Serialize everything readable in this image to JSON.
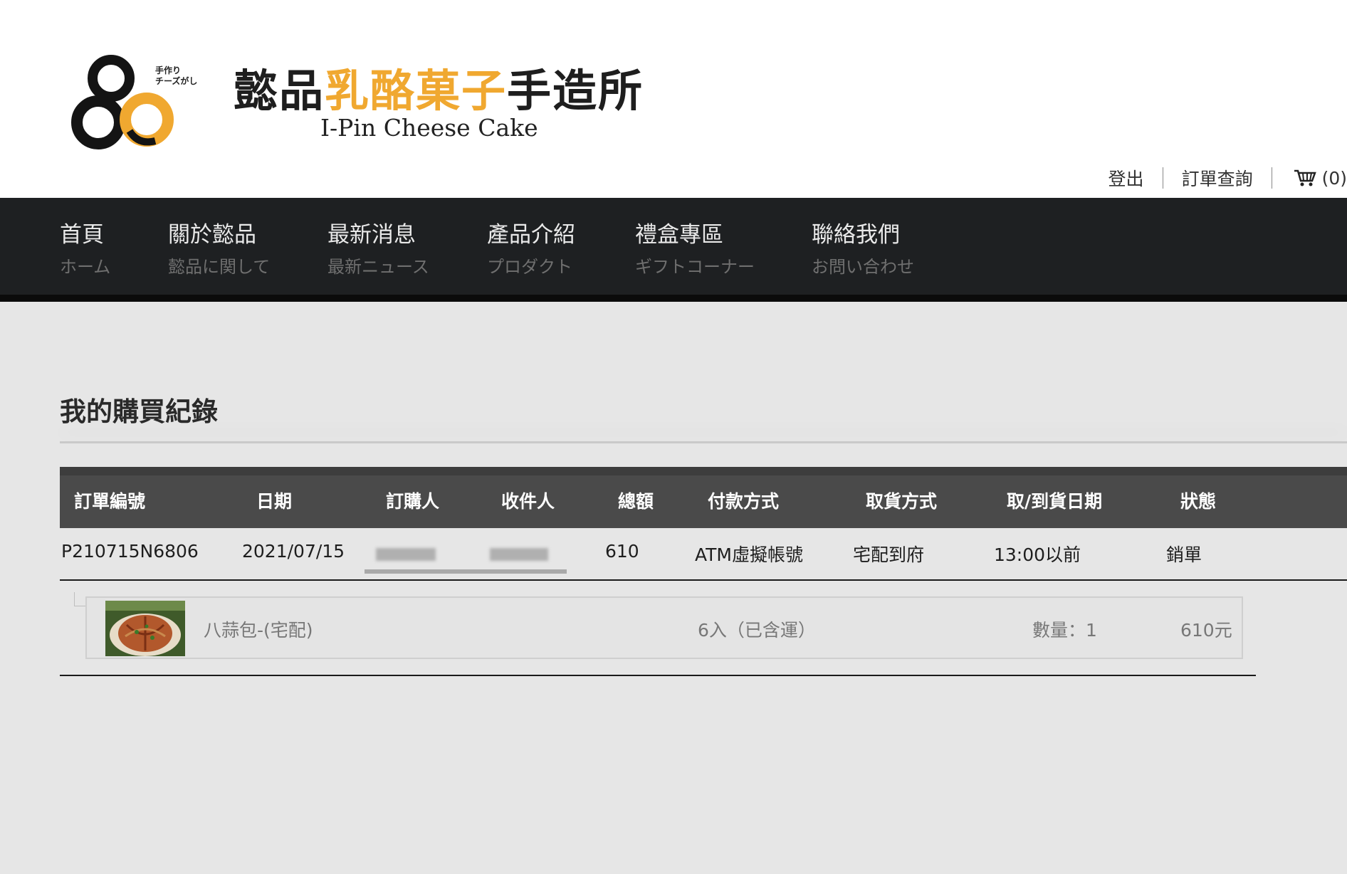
{
  "brand": {
    "tagline_lines": [
      "手作り",
      "チーズがし"
    ],
    "title_part1": "懿品",
    "title_part2": "乳酪菓子",
    "title_part3": "手造所",
    "subtitle": "I-Pin Cheese Cake",
    "colors": {
      "gold": "#f0a830",
      "dark": "#1e1e1e"
    }
  },
  "util_nav": {
    "logout": "登出",
    "order_query": "訂單查詢",
    "cart_icon": "shopping-cart-icon",
    "cart_count": "(0)"
  },
  "main_nav": [
    {
      "zh": "首頁",
      "jp": "ホーム"
    },
    {
      "zh": "關於懿品",
      "jp": "懿品に関して"
    },
    {
      "zh": "最新消息",
      "jp": "最新ニュース"
    },
    {
      "zh": "產品介紹",
      "jp": "プロダクト"
    },
    {
      "zh": "禮盒專區",
      "jp": "ギフトコーナー"
    },
    {
      "zh": "聯絡我們",
      "jp": "お問い合わせ"
    }
  ],
  "page": {
    "title": "我的購買紀錄"
  },
  "orders_table": {
    "columns": [
      "訂單編號",
      "日期",
      "訂購人",
      "收件人",
      "總額",
      "付款方式",
      "取貨方式",
      "取/到貨日期",
      "狀態"
    ],
    "rows": [
      {
        "order_no": "P210715N6806",
        "date": "2021/07/15",
        "buyer": "",
        "recipient": "",
        "total": "610",
        "payment": "ATM虛擬帳號",
        "delivery": "宅配到府",
        "delivery_date": "13:00以前",
        "status": "銷單",
        "items": [
          {
            "name": "八蒜包-(宅配)",
            "spec": "6入（已含運）",
            "qty": "數量：1",
            "price": "610元"
          }
        ]
      }
    ]
  }
}
